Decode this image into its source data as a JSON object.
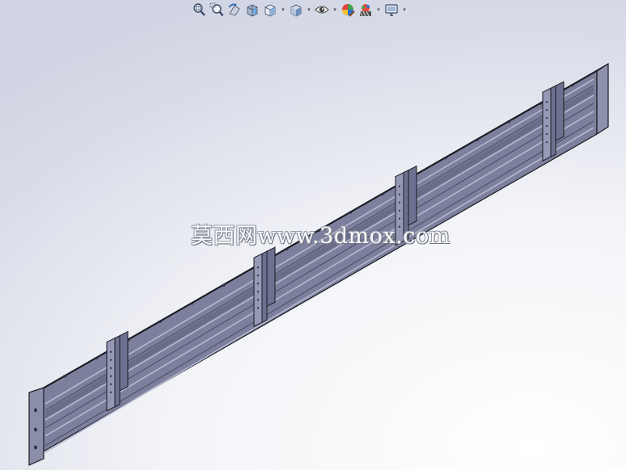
{
  "toolbar": {
    "items": [
      {
        "icon": "zoom-to-fit-icon"
      },
      {
        "icon": "zoom-to-area-icon"
      },
      {
        "icon": "previous-view-icon"
      },
      {
        "icon": "section-view-icon"
      },
      {
        "icon": "view-orientation-icon",
        "dropdown": true
      },
      {
        "icon": "display-style-icon",
        "dropdown": true
      },
      {
        "icon": "hide-show-items-icon",
        "dropdown": true
      },
      {
        "icon": "edit-appearance-icon"
      },
      {
        "icon": "apply-scene-icon",
        "dropdown": true
      },
      {
        "icon": "view-settings-icon",
        "dropdown": true
      }
    ],
    "dropdown_glyph": "▾"
  },
  "watermark": {
    "text": "莫西网www.3dmox.com"
  },
  "model": {
    "bracket_count": 4,
    "colors": {
      "top": "#a9adc8",
      "front": "#7c809c",
      "edge": "#1a1b22",
      "bracket": "#9599b5",
      "bracket_dark": "#6d7190"
    }
  }
}
